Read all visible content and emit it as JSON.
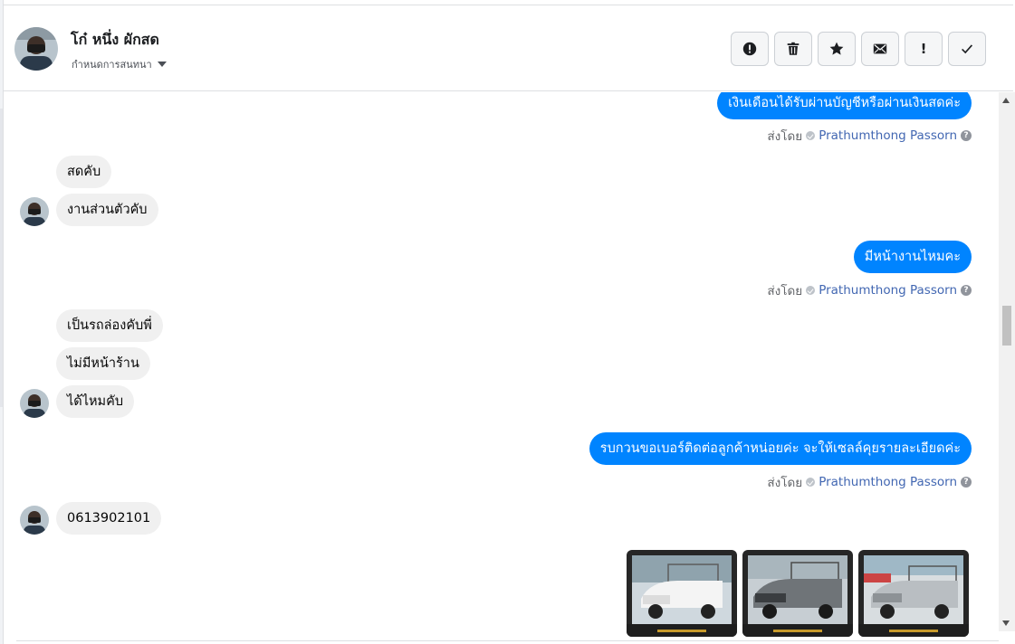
{
  "header": {
    "name": "โก๋ หนึ่ง ผักสด",
    "assign_label": "กำหนดการสนทนา",
    "actions": [
      {
        "name": "report-button",
        "icon": "alert-circle-icon"
      },
      {
        "name": "delete-button",
        "icon": "trash-icon"
      },
      {
        "name": "star-button",
        "icon": "star-icon"
      },
      {
        "name": "mark-unread-button",
        "icon": "envelope-icon"
      },
      {
        "name": "important-button",
        "icon": "exclamation-icon",
        "glyph": "!"
      },
      {
        "name": "done-button",
        "icon": "check-icon"
      }
    ]
  },
  "sender": {
    "prefix": "ส่งโดย",
    "name": "Prathumthong Passorn",
    "help": "?"
  },
  "messages": {
    "out1": "เงินเดือนได้รับผ่านบัญชีหรือผ่านเงินสดค่ะ",
    "in1": "สดคับ",
    "in2": "งานส่วนตัวคับ",
    "out2": "มีหน้างานไหมคะ",
    "in3": "เป็นรถล่องคับพี่",
    "in4": "ไม่มีหน้าร้าน",
    "in5": "ได้ไหมคับ",
    "out3": "รบกวนขอเบอร์ติดต่อลูกค้าหน่อยค่ะ จะให้เซลล์คุยรายละเอียดค่ะ",
    "in6": "0613902101"
  },
  "attachments": [
    {
      "icon": "truck-photo-white-icon"
    },
    {
      "icon": "truck-photo-dark-icon"
    },
    {
      "icon": "truck-photo-silver-icon"
    }
  ],
  "colors": {
    "outgoing_bubble": "#0084ff",
    "incoming_bubble": "#f0f0f0",
    "sender_name": "#4267b2"
  }
}
